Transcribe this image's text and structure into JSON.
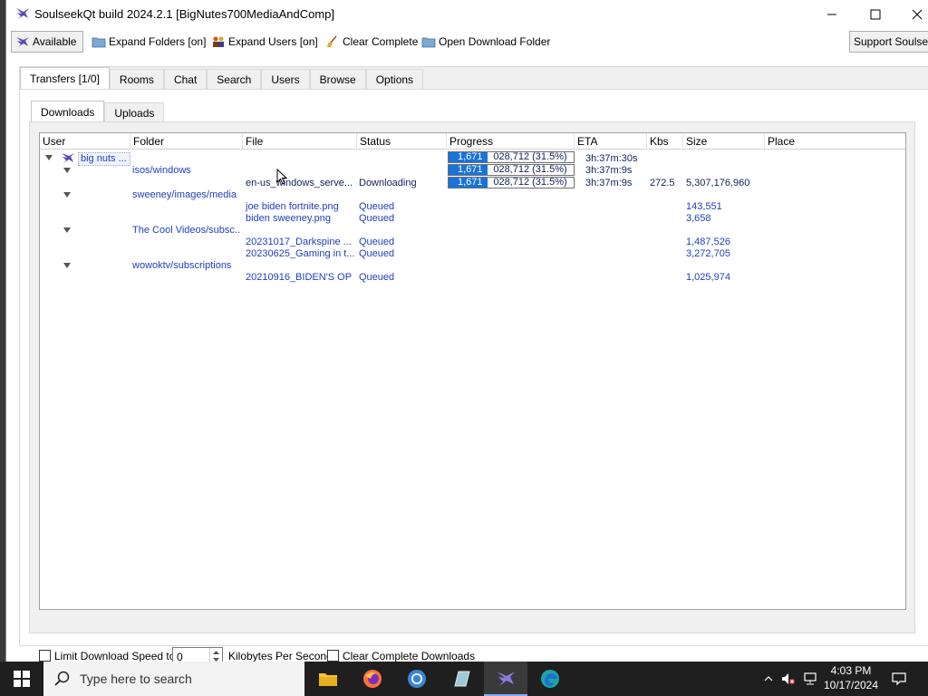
{
  "window": {
    "title": "SoulseekQt build 2024.2.1 [BigNutes700MediaAndComp]"
  },
  "toolbar": {
    "available_label": "Available",
    "expand_folders_label": "Expand Folders [on]",
    "expand_users_label": "Expand Users [on]",
    "clear_complete_label": "Clear Complete",
    "open_download_folder_label": "Open Download Folder",
    "support_label": "Support Soulseek"
  },
  "tabs": [
    "Transfers [1/0]",
    "Rooms",
    "Chat",
    "Search",
    "Users",
    "Browse",
    "Options"
  ],
  "subtabs": [
    "Downloads",
    "Uploads"
  ],
  "table": {
    "columns": [
      "User",
      "Folder",
      "File",
      "Status",
      "Progress",
      "ETA",
      "Kbs",
      "Size",
      "Place"
    ],
    "user": {
      "name": "big nuts ...",
      "progress_fill_text": "1,671",
      "progress_text": "028,712 (31.5%)",
      "progress_fraction": 0.315,
      "eta": "3h:37m:30s"
    },
    "folders": [
      {
        "name": "isos/windows",
        "progress_fill_text": "1,671",
        "progress_text": "028,712 (31.5%)",
        "eta": "3h:37m:9s",
        "files": [
          {
            "file": "en-us_windows_serve...",
            "status": "Downloading",
            "progress_fill_text": "1,671",
            "progress_text": "028,712 (31.5%)",
            "eta": "3h:37m:9s",
            "kbs": "272.5",
            "size": "5,307,176,960"
          }
        ]
      },
      {
        "name": "sweeney/images/media",
        "files": [
          {
            "file": "joe biden fortnite.png",
            "status": "Queued",
            "size": "143,551"
          },
          {
            "file": "biden sweeney.png",
            "status": "Queued",
            "size": "3,658"
          }
        ]
      },
      {
        "name": "The Cool Videos/subsc...",
        "files": [
          {
            "file": "20231017_Darkspine ...",
            "status": "Queued",
            "size": "1,487,526"
          },
          {
            "file": "20230625_Gaming in t...",
            "status": "Queued",
            "size": "3,272,705"
          }
        ]
      },
      {
        "name": "wowoktv/subscriptions",
        "files": [
          {
            "file": "20210916_BIDEN'S OP ...",
            "status": "Queued",
            "size": "1,025,974"
          }
        ]
      }
    ]
  },
  "footer": {
    "limit_speed_label": "Limit Download Speed to",
    "speed_value": "0",
    "units_label": "Kilobytes Per Second",
    "clear_complete_label": "Clear Complete Downloads"
  },
  "taskbar": {
    "search_placeholder": "Type here to search",
    "time": "4:03 PM",
    "date": "10/17/2024"
  },
  "colors": {
    "accent": "#1a73d9",
    "link_blue": "#1f3fbf",
    "navy_text": "#10205a",
    "taskbar": "#1f1f1f"
  }
}
